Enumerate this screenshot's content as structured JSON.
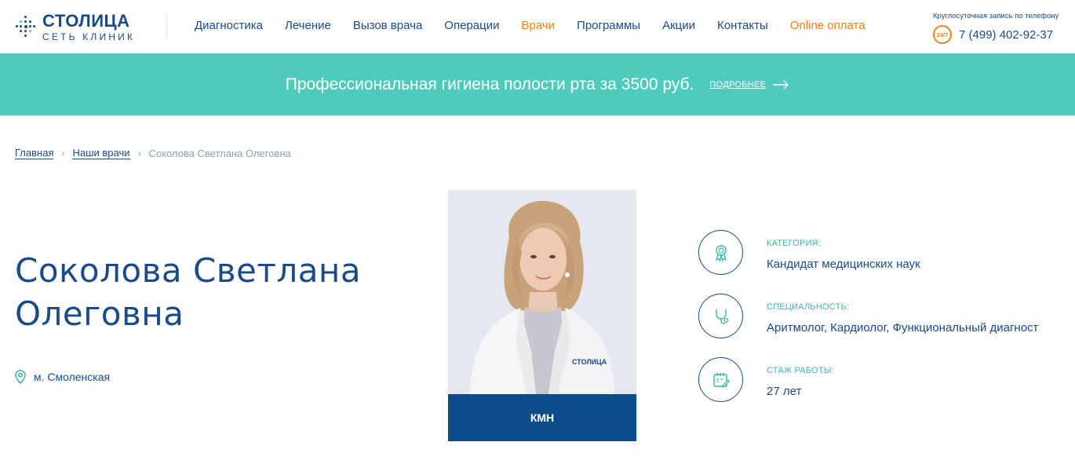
{
  "header": {
    "logo": {
      "title": "СТОЛИЦА",
      "subtitle": "СЕТЬ КЛИНИК"
    },
    "nav": [
      {
        "label": "Диагностика",
        "highlight": false
      },
      {
        "label": "Лечение",
        "highlight": false
      },
      {
        "label": "Вызов врача",
        "highlight": false
      },
      {
        "label": "Операции",
        "highlight": false
      },
      {
        "label": "Врачи",
        "highlight": true
      },
      {
        "label": "Программы",
        "highlight": false
      },
      {
        "label": "Акции",
        "highlight": false
      },
      {
        "label": "Контакты",
        "highlight": false
      },
      {
        "label": "Online оплата",
        "highlight": true
      }
    ],
    "phone": {
      "caption": "Круглосуточная запись по телефону",
      "badge": "24/7",
      "number": "7 (499) 402-92-37"
    }
  },
  "promo": {
    "text": "Профессиональная гигиена полости рта за 3500 руб.",
    "more_label": "ПОДРОБНЕЕ"
  },
  "breadcrumb": {
    "items": [
      "Главная",
      "Наши врачи"
    ],
    "current": "Соколова Светлана Олеговна"
  },
  "doctor": {
    "name_line1": "Соколова Светлана",
    "name_line2": "Олеговна",
    "metro": "м. Смоленская",
    "photo_caption": "КМН",
    "photo_coat_logo": "СТОЛИЦА"
  },
  "info": {
    "category": {
      "label": "КАТЕГОРИЯ:",
      "value": "Кандидат медицинских наук",
      "icon": "award-ribbon-icon"
    },
    "specialty": {
      "label": "СПЕЦИАЛЬНОСТЬ:",
      "value": "Аритмолог, Кардиолог, Функциональный диагност",
      "icon": "stethoscope-icon"
    },
    "experience": {
      "label": "СТАЖ РАБОТЫ:",
      "value": "27 лет",
      "icon": "calendar-edit-icon"
    }
  },
  "colors": {
    "primary": "#1a4a87",
    "accent_orange": "#f07e1b",
    "teal": "#4fcbbb",
    "caption_bg": "#0d4d8c"
  }
}
